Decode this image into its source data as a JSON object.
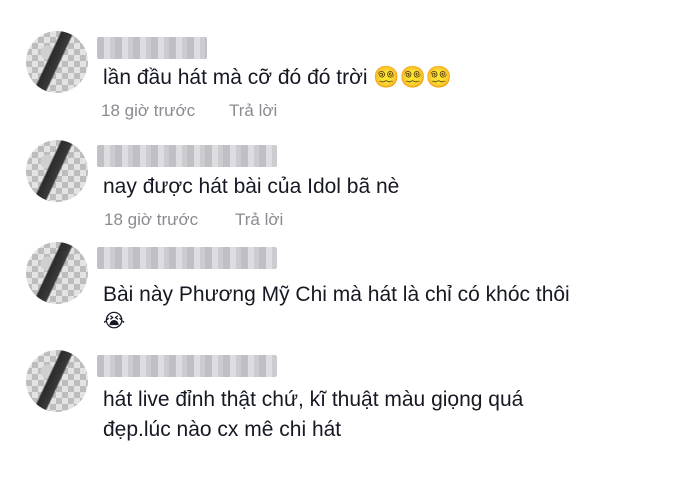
{
  "comments": [
    {
      "text": "lần đầu hát mà cỡ đó đó trời 😵‍💫😵‍💫😵‍💫",
      "time": "18 giờ trước",
      "reply": "Trả lời"
    },
    {
      "text": "nay được hát bài của Idol bã nè",
      "time": "18 giờ trước",
      "reply": "Trả lời"
    },
    {
      "text": "Bài này Phương Mỹ Chi mà hát là chỉ có khóc thôi",
      "text_line2": "😭"
    },
    {
      "text": "hát live đỉnh thật chứ, kĩ thuật màu giọng quá",
      "text_line2": "đẹp.lúc nào cx mê chi hát"
    }
  ]
}
